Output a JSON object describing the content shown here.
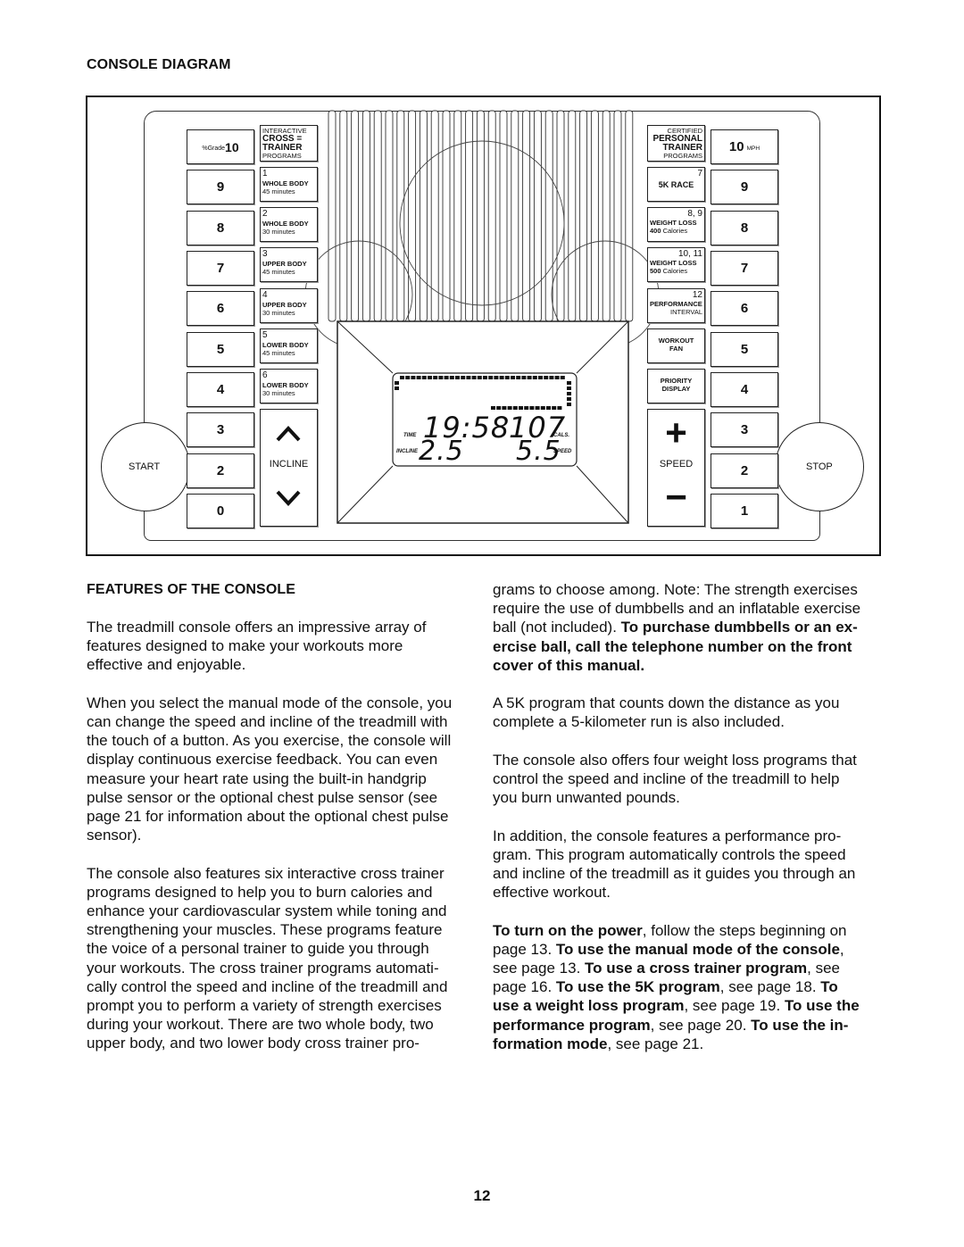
{
  "diagram": {
    "title": "CONSOLE DIAGRAM",
    "left_speed_prefix": "%Grade",
    "left_numbers": [
      "10",
      "9",
      "8",
      "7",
      "6",
      "5",
      "4",
      "3",
      "2",
      "0"
    ],
    "left_header": [
      "INTERACTIVE",
      "CROSS =",
      "TRAINER",
      "PROGRAMS"
    ],
    "left_programs": [
      {
        "num": "1",
        "title": "WHOLE BODY",
        "sub": "45 minutes"
      },
      {
        "num": "2",
        "title": "WHOLE BODY",
        "sub": "30 minutes"
      },
      {
        "num": "3",
        "title": "UPPER BODY",
        "sub": "45 minutes"
      },
      {
        "num": "4",
        "title": "UPPER BODY",
        "sub": "30 minutes"
      },
      {
        "num": "5",
        "title": "LOWER BODY",
        "sub": "45 minutes"
      },
      {
        "num": "6",
        "title": "LOWER BODY",
        "sub": "30 minutes"
      }
    ],
    "incline_label": "INCLINE",
    "start_label": "START",
    "stop_label": "STOP",
    "right_header": [
      "CERTIFIED",
      "PERSONAL",
      "TRAINER",
      "PROGRAMS"
    ],
    "right_programs": [
      {
        "num": "7",
        "title": "5K RACE",
        "sub": ""
      },
      {
        "num": "8, 9",
        "title": "WEIGHT LOSS",
        "sub_bold": "400",
        "sub": " Calories"
      },
      {
        "num": "10, 11",
        "title": "WEIGHT LOSS",
        "sub_bold": "500",
        "sub": " Calories"
      },
      {
        "num": "12",
        "title": "PERFORMANCE",
        "sub": "INTERVAL"
      },
      {
        "num": "",
        "title": "WORKOUT",
        "sub": "FAN"
      },
      {
        "num": "",
        "title": "PRIORITY",
        "sub": "DISPLAY"
      }
    ],
    "right_numbers": [
      "10",
      "9",
      "8",
      "7",
      "6",
      "5",
      "4",
      "3",
      "2",
      "1"
    ],
    "right_speed_suffix": "MPH",
    "speed_label": "SPEED",
    "plus": "+",
    "minus": "−",
    "display": {
      "time_label": "TIME",
      "time": "19:58",
      "cals": "107",
      "cals_label": "CALS.",
      "incline_label": "INCLINE",
      "incline": "2.5",
      "speed": "5.5",
      "speed_label": "SPEED"
    }
  },
  "features": {
    "heading": "FEATURES OF THE CONSOLE",
    "left_paragraphs": [
      [
        "The treadmill console offers an impressive array of",
        "features designed to make your workouts more",
        "effective and enjoyable."
      ],
      [
        "When you select the manual mode of the console, you",
        "can change the speed and incline of the treadmill with",
        "the touch of a button. As you exercise, the console will",
        "display continuous exercise feedback. You can even",
        "measure your heart rate using the built-in handgrip",
        "pulse sensor or the optional chest pulse sensor (see",
        "page 21 for information about the optional chest pulse",
        "sensor)."
      ],
      [
        "The console also features six interactive cross trainer",
        "programs designed to help you to burn calories and",
        "enhance your cardiovascular system while toning and",
        "strengthening your muscles. These programs feature",
        "the voice of a personal trainer to guide you through",
        "your workouts. The cross trainer programs automati-",
        "cally control the speed and incline of the treadmill and",
        "prompt you to perform a variety of strength exercises",
        "during your workout. There are two whole body, two",
        "upper body, and two lower body cross trainer pro-"
      ]
    ],
    "right_paragraphs": [
      [
        "grams to choose among. Note: The strength exercises",
        "require the use of dumbbells and an inflatable exercise",
        [
          {
            "t": "ball (not included). "
          },
          {
            "t": "To purchase dumbbells or an ex-",
            "b": true
          }
        ],
        [
          {
            "t": "ercise ball, call the telephone number on the front",
            "b": true
          }
        ],
        [
          {
            "t": "cover of this manual.",
            "b": true
          }
        ]
      ],
      [
        "A 5K program that counts down the distance as you",
        "complete a 5-kilometer run is also included."
      ],
      [
        "The console also offers four weight loss programs that",
        "control the speed and incline of the treadmill to help",
        "you burn unwanted pounds."
      ],
      [
        "In addition, the console features a performance pro-",
        "gram. This program automatically controls the speed",
        "and incline of the treadmill as it guides you through an",
        "effective workout."
      ],
      [
        [
          {
            "t": "To turn on the power",
            "b": true
          },
          {
            "t": ", follow the steps beginning on"
          }
        ],
        [
          {
            "t": "page 13. "
          },
          {
            "t": "To use the manual mode of the console",
            "b": true
          },
          {
            "t": ","
          }
        ],
        [
          {
            "t": "see page 13. "
          },
          {
            "t": "To use a cross trainer program",
            "b": true
          },
          {
            "t": ", see"
          }
        ],
        [
          {
            "t": "page 16. "
          },
          {
            "t": "To use the 5K program",
            "b": true
          },
          {
            "t": ", see page 18. "
          },
          {
            "t": "To",
            "b": true
          }
        ],
        [
          {
            "t": "use a weight loss program",
            "b": true
          },
          {
            "t": ", see page 19. "
          },
          {
            "t": "To use the",
            "b": true
          }
        ],
        [
          {
            "t": "performance program",
            "b": true
          },
          {
            "t": ", see page 20. "
          },
          {
            "t": "To use the in-",
            "b": true
          }
        ],
        [
          {
            "t": "formation mode",
            "b": true
          },
          {
            "t": ", see page 21."
          }
        ]
      ]
    ]
  },
  "page_number": "12"
}
